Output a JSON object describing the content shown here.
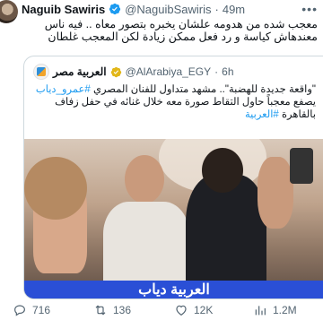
{
  "author": {
    "name": "Naguib Sawiris",
    "handle": "@NaguibSawiris",
    "separator": "·",
    "time": "49m"
  },
  "tweet_text": "معجب شده من هدومه علشان يخبره بتصور معاه .. فيه ناس معندهاش كياسة و رد فعل ممكن زيادة لكن المعجب غلطان",
  "quoted": {
    "name": "العربية مصر",
    "handle": "@AlArabiya_EGY",
    "separator": "·",
    "time": "6h",
    "text_plain": "\"واقعة جديدة للهضبة\".. مشهد متداول للفنان المصري ",
    "tag1": "#عمرو_دياب",
    "text_plain2": " يصفع معجباً حاول التقاط صورة معه خلال غنائه في حفل زفاف بالقاهرة ",
    "tag2": "#العربية",
    "media_caption": "العربية دياب"
  },
  "actions": {
    "reply_count": "716",
    "retweet_count": "136",
    "like_count": "12K",
    "views_count": "1.2M"
  },
  "icons": {
    "verified": "verified-badge-icon",
    "more": "more-options-icon",
    "reply": "reply-icon",
    "retweet": "retweet-icon",
    "like": "heart-icon",
    "views": "views-chart-icon"
  },
  "colors": {
    "verified_blue": "#1d9bf0",
    "gold_check": "#e2b719",
    "hashtag_blue": "#1d9bf0",
    "caption_bar": "#2a4fd6"
  }
}
